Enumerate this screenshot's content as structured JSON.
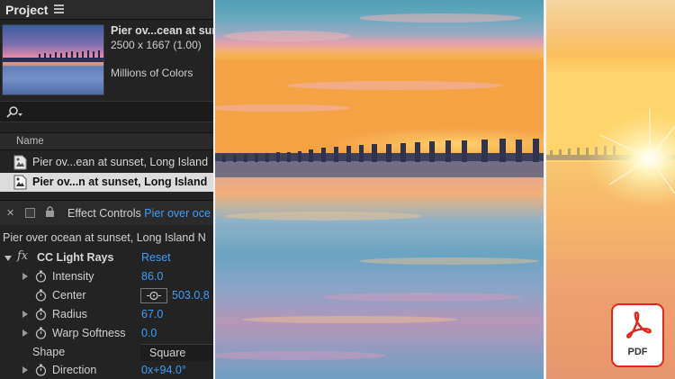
{
  "project": {
    "title": "Project",
    "item_name": "Pier ov...cean at sun",
    "dimensions": "2500 x 1667 (1.00)",
    "color_depth": "Millions of Colors",
    "column_name": "Name",
    "files": [
      {
        "label": "Pier ov...ean at sunset, Long Island"
      },
      {
        "label": "Pier ov...n at sunset, Long Island"
      }
    ]
  },
  "effect_controls": {
    "title": "Effect Controls",
    "layer_link": "Pier over oce",
    "composition_path": "Pier over ocean at sunset, Long Island N",
    "effect": {
      "name": "CC Light Rays",
      "reset_label": "Reset"
    },
    "properties": [
      {
        "label": "Intensity",
        "value": "86.0"
      },
      {
        "label": "Center",
        "value": "503.0,8"
      },
      {
        "label": "Radius",
        "value": "67.0"
      },
      {
        "label": "Warp Softness",
        "value": "0.0"
      },
      {
        "label": "Shape",
        "value": "Square"
      },
      {
        "label": "Direction",
        "value": "0x+94.0°"
      }
    ]
  },
  "badge": {
    "label": "PDF"
  },
  "colors": {
    "accent_blue": "#3e9ff5",
    "pdf_red": "#e1261c",
    "panel_bg": "#232323"
  }
}
